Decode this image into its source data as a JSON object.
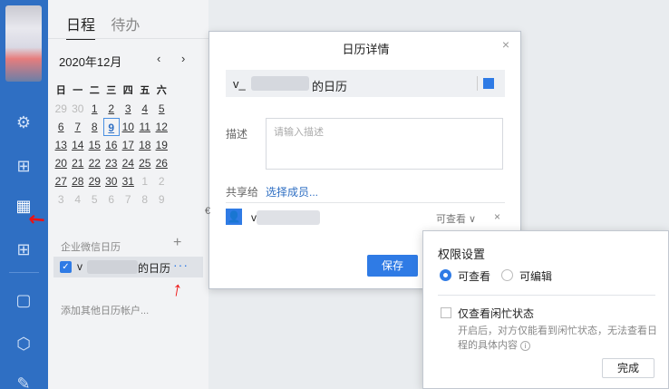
{
  "rail": {
    "icons": [
      "puzzle-icon",
      "org-chart-icon",
      "calendar-icon",
      "apps-icon",
      "doc-icon",
      "cube-icon",
      "feather-icon"
    ]
  },
  "calendar": {
    "tabs": [
      "日程",
      "待办"
    ],
    "month": "2020年12月",
    "prev": "‹",
    "next": "›",
    "weekdays": [
      "日",
      "一",
      "二",
      "三",
      "四",
      "五",
      "六"
    ],
    "weeks": [
      [
        "29",
        "30",
        "1",
        "2",
        "3",
        "4",
        "5"
      ],
      [
        "6",
        "7",
        "8",
        "9",
        "10",
        "11",
        "12"
      ],
      [
        "13",
        "14",
        "15",
        "16",
        "17",
        "18",
        "19"
      ],
      [
        "20",
        "21",
        "22",
        "23",
        "24",
        "25",
        "26"
      ],
      [
        "27",
        "28",
        "29",
        "30",
        "31",
        "1",
        "2"
      ],
      [
        "3",
        "4",
        "5",
        "6",
        "7",
        "8",
        "9"
      ]
    ],
    "today": "9",
    "section_label": "企业微信日历",
    "add": "+",
    "item_prefix": "v",
    "item_suffix": "的日历",
    "more": "···",
    "add_account": "添加其他日历帐户..."
  },
  "dialog": {
    "title": "日历详情",
    "close": "×",
    "cal_prefix": "v_",
    "cal_suffix": "的日历",
    "desc_label": "描述",
    "desc_placeholder": "请输入描述",
    "share_label": "共享给",
    "choose_members": "选择成员...",
    "member_initial": "v",
    "permission": "可查看 ∨",
    "remove": "×",
    "save": "保存",
    "edge": "€"
  },
  "popover": {
    "title": "权限设置",
    "options": [
      "可查看",
      "可编辑"
    ],
    "selected": "可查看",
    "busy_only": "仅查看闲忙状态",
    "hint": "开启后，对方仅能看到闲忙状态，无法查看日程的具体内容",
    "info": "i",
    "done": "完成"
  },
  "colors": {
    "accent": "#2f7be5",
    "rail": "#2f6fc3"
  }
}
